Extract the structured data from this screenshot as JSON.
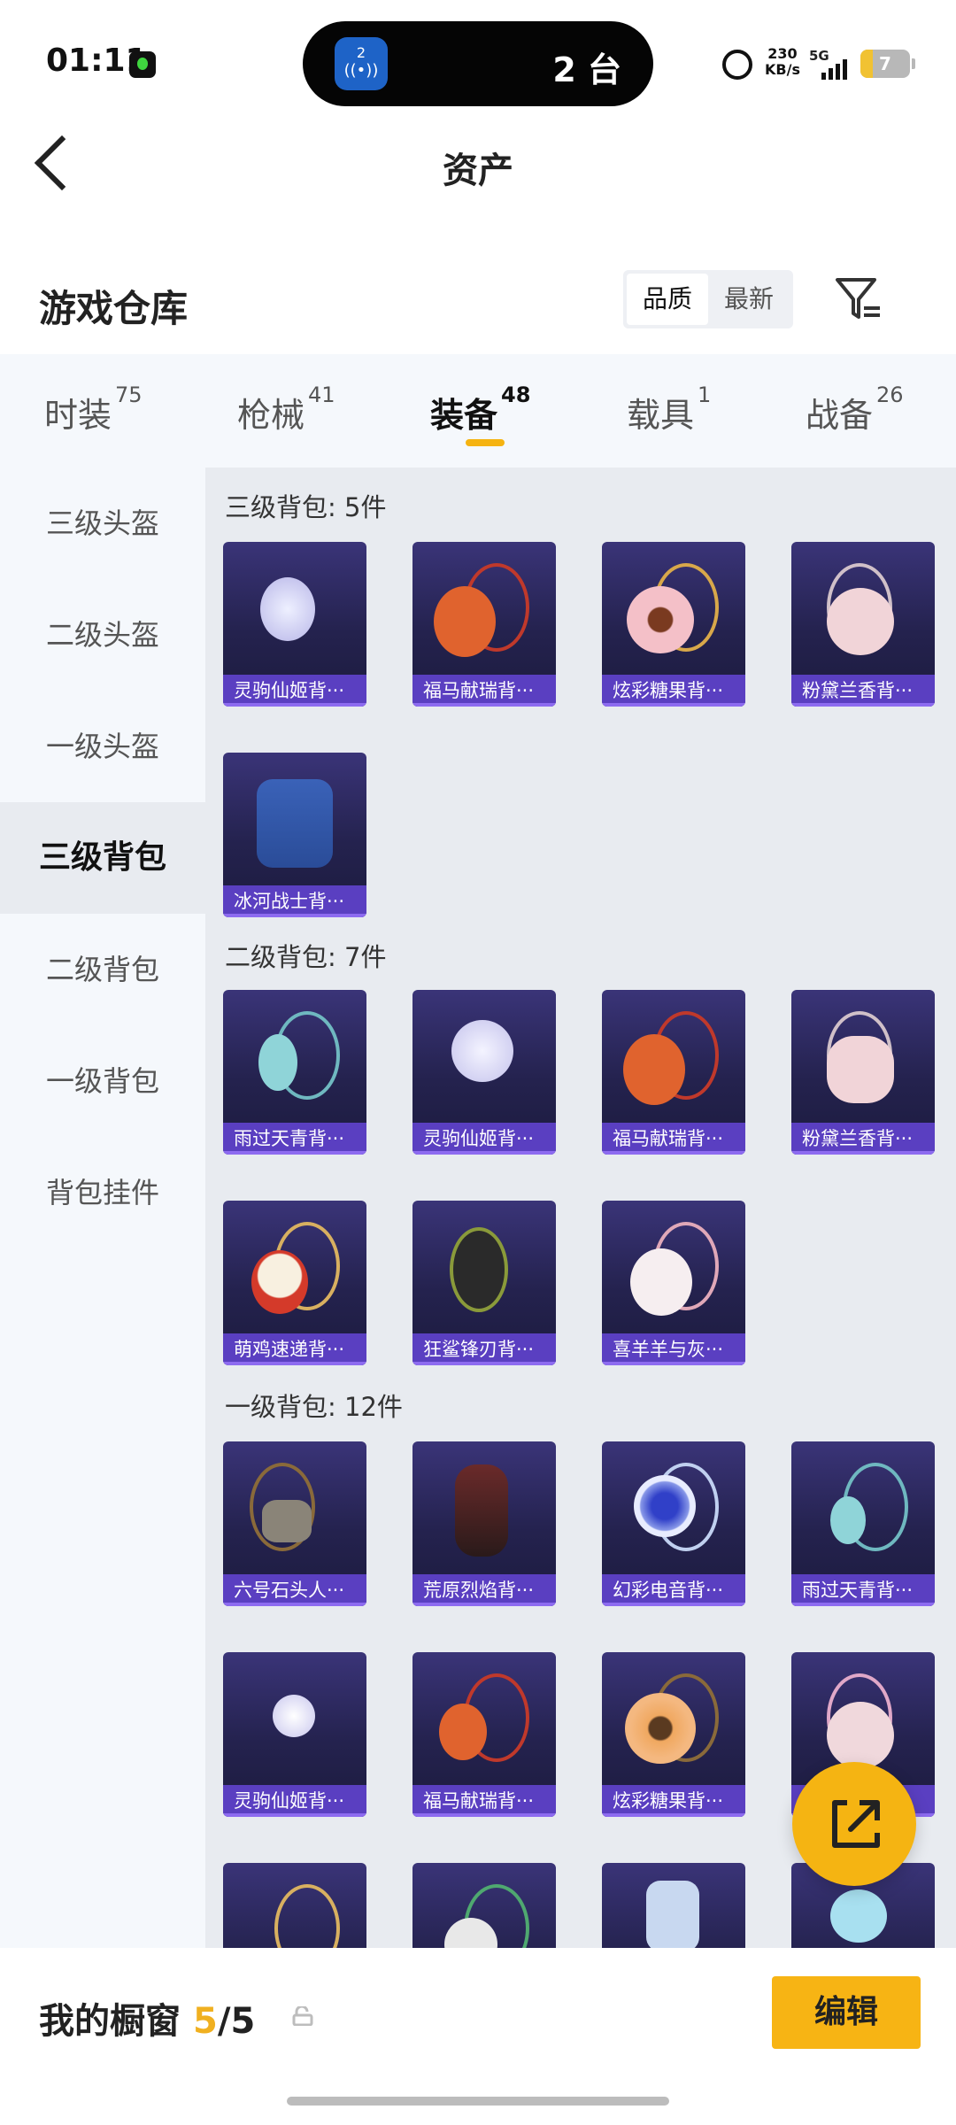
{
  "status_bar": {
    "time": "01:11",
    "island_badge": "2",
    "island_text": "2 台",
    "net_speed_value": "230",
    "net_speed_unit": "KB/s",
    "network": "5G",
    "battery": "7"
  },
  "header": {
    "title": "资产"
  },
  "warehouse": {
    "title": "游戏仓库",
    "sort_options": [
      "品质",
      "最新"
    ],
    "sort_selected": "品质"
  },
  "tabs": [
    {
      "label": "时装",
      "count": "75"
    },
    {
      "label": "枪械",
      "count": "41"
    },
    {
      "label": "装备",
      "count": "48",
      "active": true
    },
    {
      "label": "载具",
      "count": "1"
    },
    {
      "label": "战备",
      "count": "26"
    }
  ],
  "sidebar": [
    {
      "label": "三级头盔"
    },
    {
      "label": "二级头盔"
    },
    {
      "label": "一级头盔"
    },
    {
      "label": "三级背包",
      "active": true
    },
    {
      "label": "二级背包"
    },
    {
      "label": "一级背包"
    },
    {
      "label": "背包挂件"
    }
  ],
  "groups": [
    {
      "title": "三级背包: 5件",
      "items": [
        "灵驹仙姬背···",
        "福马献瑞背···",
        "炫彩糖果背···",
        "粉黛兰香背···",
        "冰河战士背···"
      ]
    },
    {
      "title": "二级背包: 7件",
      "items": [
        "雨过天青背···",
        "灵驹仙姬背···",
        "福马献瑞背···",
        "粉黛兰香背···",
        "萌鸡速递背···",
        "狂鲨锋刃背···",
        "喜羊羊与灰···"
      ]
    },
    {
      "title": "一级背包: 12件",
      "items": [
        "六号石头人···",
        "荒原烈焰背···",
        "幻彩电音背···",
        "雨过天青背···",
        "灵驹仙姬背···",
        "福马献瑞背···",
        "炫彩糖果背···",
        "",
        "",
        "",
        "",
        ""
      ]
    }
  ],
  "showcase": {
    "label": "我的橱窗",
    "current": "5",
    "total": "/5"
  },
  "edit_button": "编辑",
  "colors": {
    "accent": "#f7b414",
    "card_label": "#5a3fc1"
  }
}
